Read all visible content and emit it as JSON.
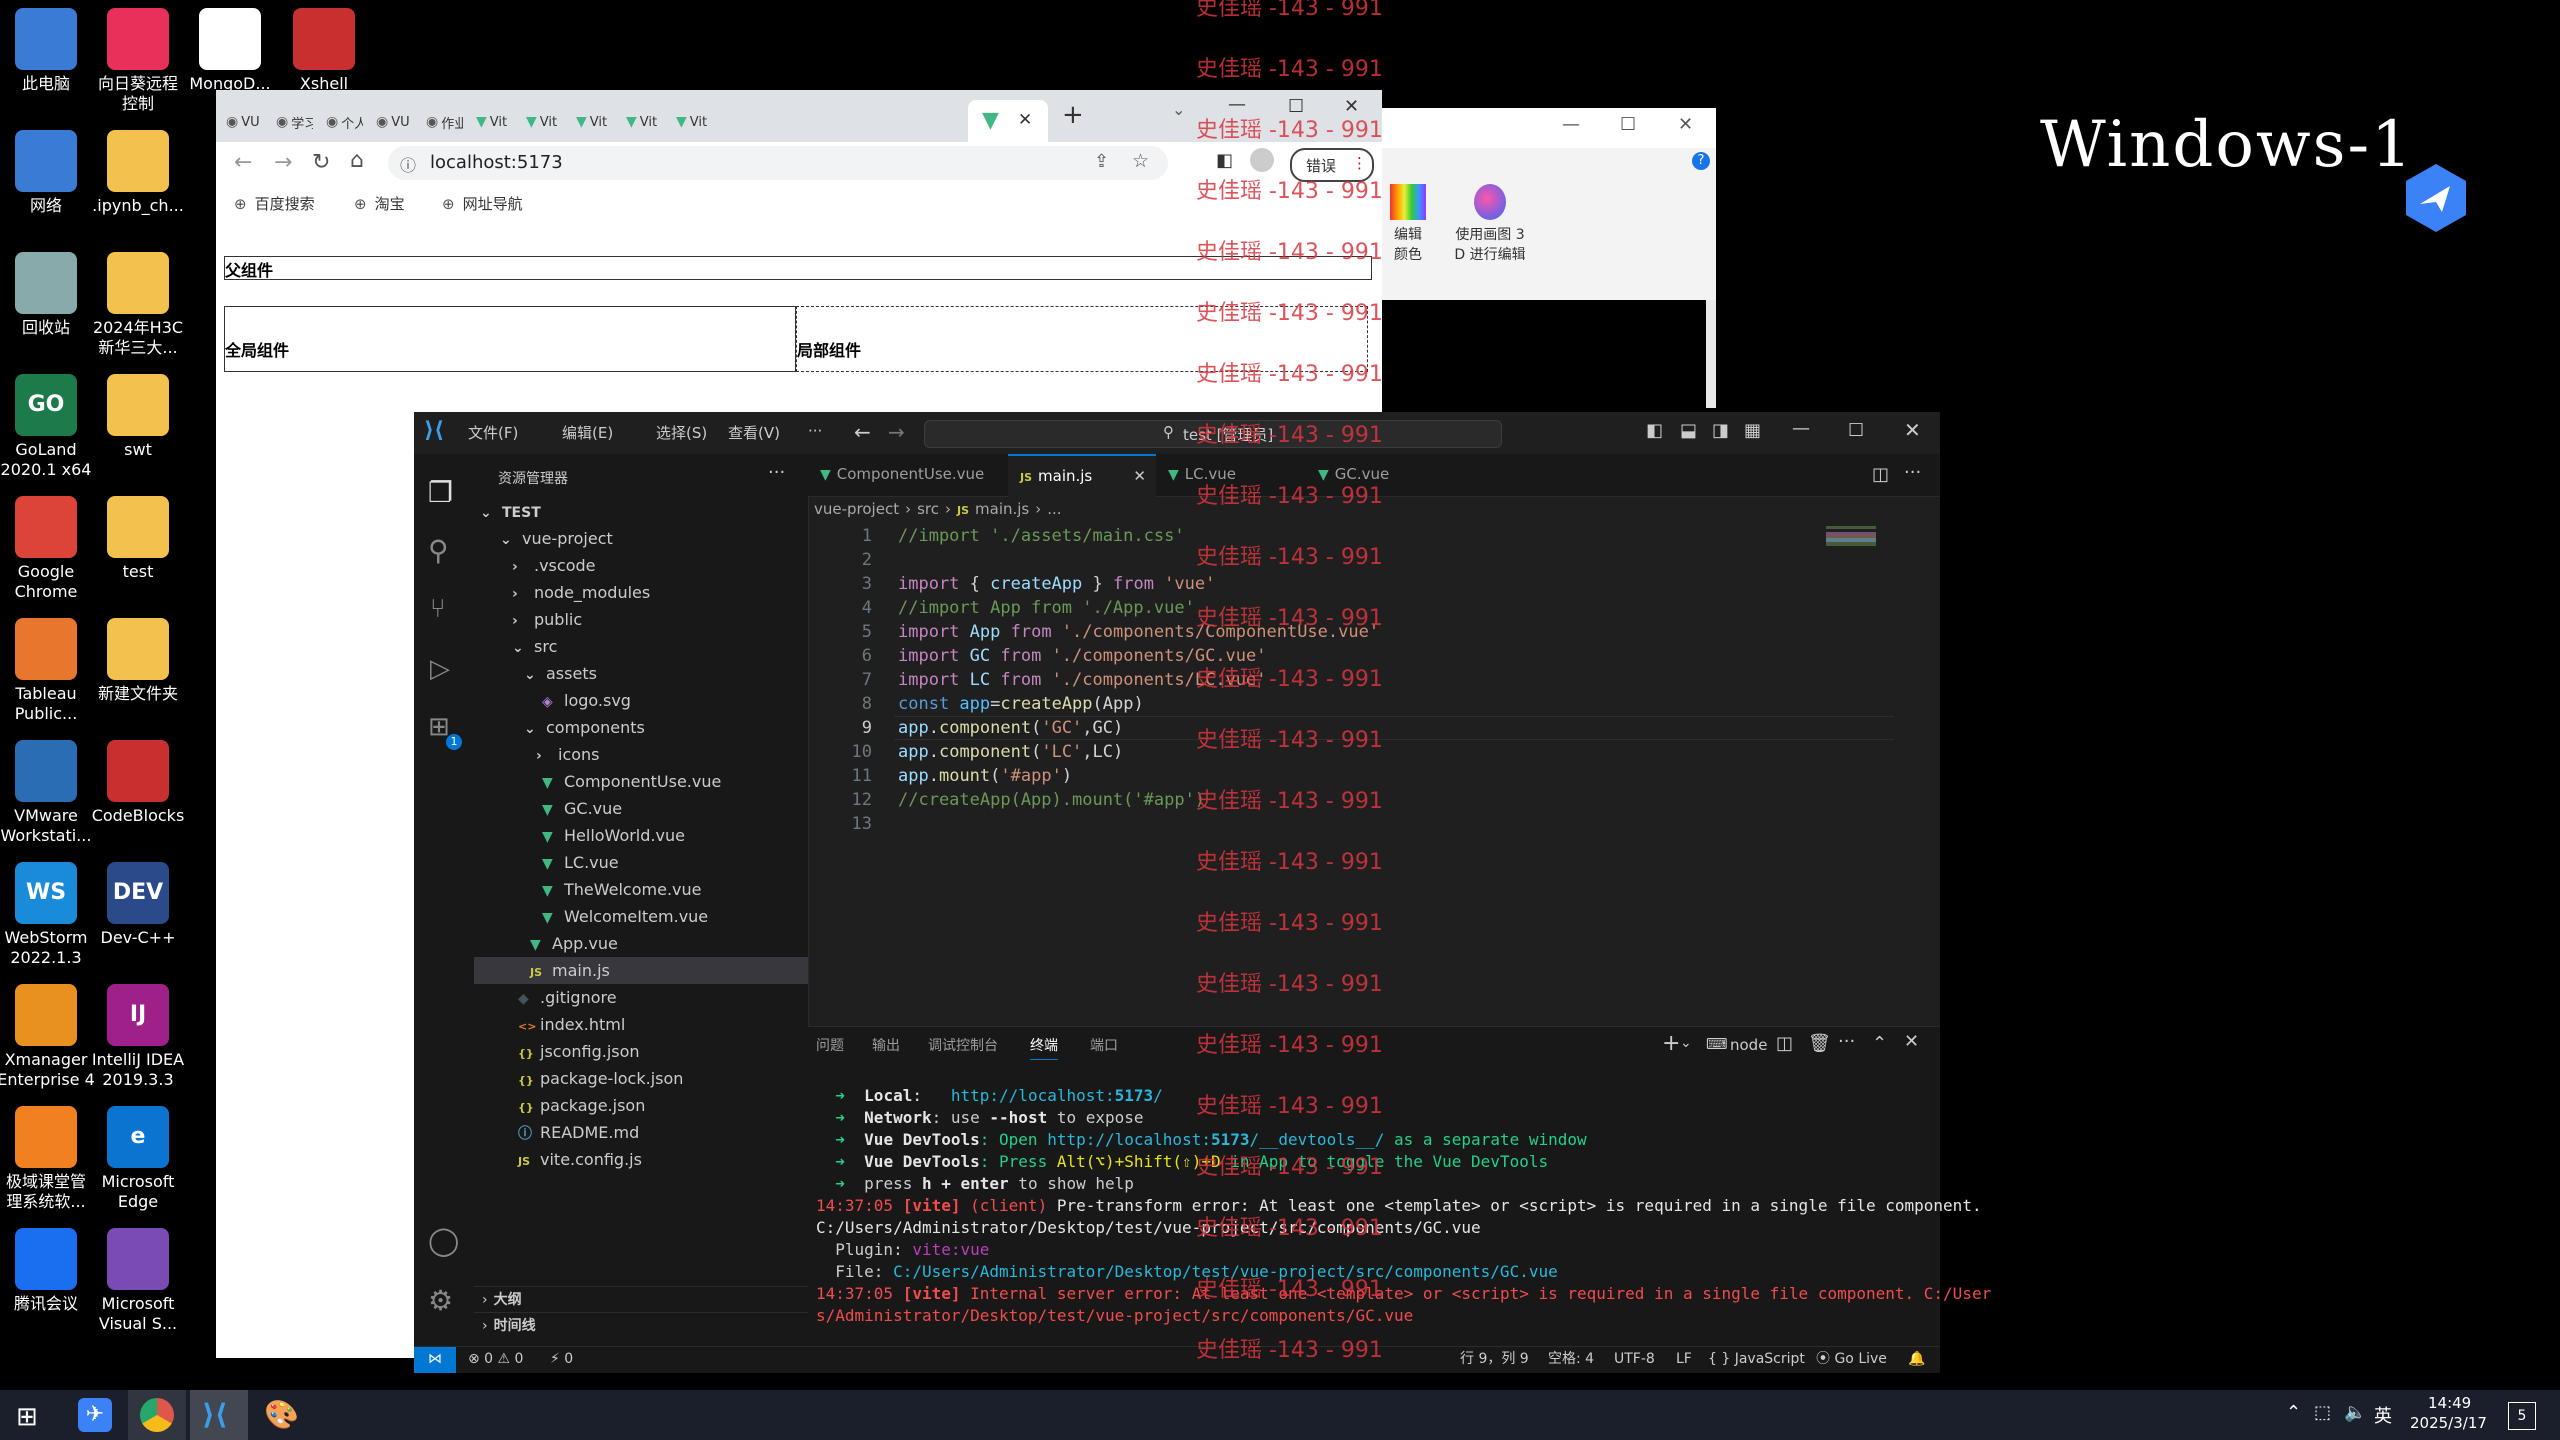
{
  "desktop": {
    "icons_col1": [
      {
        "label": "此电脑",
        "icon": "computer-icon",
        "color": "#3a7bd5"
      },
      {
        "label": "网络",
        "icon": "network-icon",
        "color": "#3a7bd5"
      },
      {
        "label": "回收站",
        "icon": "recycle-bin-icon",
        "color": "#8aa"
      },
      {
        "label": "GoLand\n2020.1 x64",
        "icon": "goland-icon",
        "color": "#1d7a4a",
        "text": "GO"
      },
      {
        "label": "Google\nChrome",
        "icon": "chrome-icon",
        "color": "#db4437"
      },
      {
        "label": "Tableau\nPublic...",
        "icon": "tableau-icon",
        "color": "#e8762d"
      },
      {
        "label": "VMware\nWorkstati...",
        "icon": "vmware-icon",
        "color": "#2a6db5"
      },
      {
        "label": "WebStorm\n2022.1.3",
        "icon": "webstorm-icon",
        "color": "#1a8bd8",
        "text": "WS"
      },
      {
        "label": "Xmanager\nEnterprise 4",
        "icon": "xmanager-icon",
        "color": "#e89020"
      },
      {
        "label": "极域课堂管\n理系统软...",
        "icon": "classroom-icon",
        "color": "#f08020"
      },
      {
        "label": "腾讯会议",
        "icon": "tencent-meeting-icon",
        "color": "#1a6ef0"
      }
    ],
    "icons_col2": [
      {
        "label": "向日葵远程\n控制",
        "icon": "sunlogin-icon",
        "color": "#e8305a"
      },
      {
        "label": ".ipynb_ch...",
        "icon": "folder-icon",
        "color": "#f2c14e"
      },
      {
        "label": "2024年H3C\n新华三大...",
        "icon": "folder-icon",
        "color": "#f2c14e"
      },
      {
        "label": "swt",
        "icon": "folder-icon",
        "color": "#f2c14e"
      },
      {
        "label": "test",
        "icon": "folder-icon",
        "color": "#f2c14e"
      },
      {
        "label": "新建文件夹",
        "icon": "folder-icon",
        "color": "#f2c14e"
      },
      {
        "label": "CodeBlocks",
        "icon": "codeblocks-icon",
        "color": "#c83030"
      },
      {
        "label": "Dev-C++",
        "icon": "devcpp-icon",
        "color": "#2a4a8a",
        "text": "DEV"
      },
      {
        "label": "IntelliJ IDEA\n2019.3.3",
        "icon": "intellij-icon",
        "color": "#a0208a",
        "text": "IJ"
      },
      {
        "label": "Microsoft\nEdge",
        "icon": "edge-icon",
        "color": "#0a74d0",
        "text": "e"
      },
      {
        "label": "Microsoft\nVisual S...",
        "icon": "visual-studio-icon",
        "color": "#7a4ab5"
      }
    ],
    "icons_top": [
      {
        "label": "MongoD...",
        "icon": "mongodb-icon",
        "color": "#fff"
      },
      {
        "label": "Xshell",
        "icon": "xshell-icon",
        "color": "#c83030"
      }
    ],
    "brand_text": "Windows-1",
    "watermark": "史佳瑶 -143 - 991"
  },
  "chrome": {
    "tabs": [
      "VU",
      "学习",
      "个人",
      "VU",
      "作业",
      "Vit",
      "Vit",
      "Vit",
      "Vit",
      "Vit"
    ],
    "new_tab_label": "+",
    "address": "localhost:5173",
    "error_chip": "错误",
    "bookmarks": [
      "百度搜索",
      "淘宝",
      "网址导航"
    ],
    "page": {
      "parent_title": "父组件",
      "global_title": "全局组件",
      "local_title": "局部组件"
    }
  },
  "explorer_window": {
    "btn1": "编辑\n颜色",
    "btn2": "使用画图 3\nD 进行编辑"
  },
  "vscode": {
    "menu": [
      "文件(F)",
      "编辑(E)",
      "选择(S)",
      "查看(V)",
      "···"
    ],
    "search_text": "test [管理员]",
    "sidebar_title": "资源管理器",
    "tree": [
      {
        "label": "TEST",
        "depth": 0,
        "kind": "root"
      },
      {
        "label": "vue-project",
        "depth": 1,
        "kind": "folder-open"
      },
      {
        "label": ".vscode",
        "depth": 2,
        "kind": "folder"
      },
      {
        "label": "node_modules",
        "depth": 2,
        "kind": "folder"
      },
      {
        "label": "public",
        "depth": 2,
        "kind": "folder"
      },
      {
        "label": "src",
        "depth": 2,
        "kind": "folder-open"
      },
      {
        "label": "assets",
        "depth": 3,
        "kind": "folder-open"
      },
      {
        "label": "logo.svg",
        "depth": 4,
        "kind": "svg"
      },
      {
        "label": "components",
        "depth": 3,
        "kind": "folder-open"
      },
      {
        "label": "icons",
        "depth": 4,
        "kind": "folder"
      },
      {
        "label": "ComponentUse.vue",
        "depth": 4,
        "kind": "vue"
      },
      {
        "label": "GC.vue",
        "depth": 4,
        "kind": "vue"
      },
      {
        "label": "HelloWorld.vue",
        "depth": 4,
        "kind": "vue"
      },
      {
        "label": "LC.vue",
        "depth": 4,
        "kind": "vue"
      },
      {
        "label": "TheWelcome.vue",
        "depth": 4,
        "kind": "vue"
      },
      {
        "label": "WelcomeItem.vue",
        "depth": 4,
        "kind": "vue"
      },
      {
        "label": "App.vue",
        "depth": 3,
        "kind": "vue"
      },
      {
        "label": "main.js",
        "depth": 3,
        "kind": "js",
        "active": true
      },
      {
        "label": ".gitignore",
        "depth": 2,
        "kind": "git"
      },
      {
        "label": "index.html",
        "depth": 2,
        "kind": "html"
      },
      {
        "label": "jsconfig.json",
        "depth": 2,
        "kind": "json"
      },
      {
        "label": "package-lock.json",
        "depth": 2,
        "kind": "json"
      },
      {
        "label": "package.json",
        "depth": 2,
        "kind": "json"
      },
      {
        "label": "README.md",
        "depth": 2,
        "kind": "md"
      },
      {
        "label": "vite.config.js",
        "depth": 2,
        "kind": "js"
      }
    ],
    "outline_label": "大纲",
    "timeline_label": "时间线",
    "editor_tabs": [
      {
        "label": "ComponentUse.vue",
        "kind": "vue",
        "active": false
      },
      {
        "label": "main.js",
        "kind": "js",
        "active": true
      },
      {
        "label": "LC.vue",
        "kind": "vue",
        "active": false
      },
      {
        "label": "GC.vue",
        "kind": "vue",
        "active": false
      }
    ],
    "breadcrumb": [
      "vue-project",
      "src",
      "main.js",
      "..."
    ],
    "code": [
      [
        {
          "t": "//import './assets/main.css'",
          "c": "#6a9955"
        }
      ],
      [],
      [
        {
          "t": "import",
          "c": "#c586c0"
        },
        {
          "t": " { ",
          "c": "#d4d4d4"
        },
        {
          "t": "createApp",
          "c": "#9cdcfe"
        },
        {
          "t": " } ",
          "c": "#d4d4d4"
        },
        {
          "t": "from",
          "c": "#c586c0"
        },
        {
          "t": " 'vue'",
          "c": "#ce9178"
        }
      ],
      [
        {
          "t": "//import App from './App.vue'",
          "c": "#6a9955"
        }
      ],
      [
        {
          "t": "import",
          "c": "#c586c0"
        },
        {
          "t": " App ",
          "c": "#9cdcfe"
        },
        {
          "t": "from",
          "c": "#c586c0"
        },
        {
          "t": " './components/ComponentUse.vue'",
          "c": "#ce9178"
        }
      ],
      [
        {
          "t": "import",
          "c": "#c586c0"
        },
        {
          "t": " GC ",
          "c": "#9cdcfe"
        },
        {
          "t": "from",
          "c": "#c586c0"
        },
        {
          "t": " './components/GC.vue'",
          "c": "#ce9178"
        }
      ],
      [
        {
          "t": "import",
          "c": "#c586c0"
        },
        {
          "t": " LC ",
          "c": "#9cdcfe"
        },
        {
          "t": "from",
          "c": "#c586c0"
        },
        {
          "t": " './components/LC.vue'",
          "c": "#ce9178"
        }
      ],
      [
        {
          "t": "const",
          "c": "#569cd6"
        },
        {
          "t": " app",
          "c": "#4fc1ff"
        },
        {
          "t": "=",
          "c": "#d4d4d4"
        },
        {
          "t": "createApp",
          "c": "#dcdcaa"
        },
        {
          "t": "(App)",
          "c": "#d4d4d4"
        }
      ],
      [
        {
          "t": "app",
          "c": "#9cdcfe"
        },
        {
          "t": ".",
          "c": "#d4d4d4"
        },
        {
          "t": "component",
          "c": "#dcdcaa"
        },
        {
          "t": "(",
          "c": "#d4d4d4"
        },
        {
          "t": "'GC'",
          "c": "#ce9178"
        },
        {
          "t": ",GC)",
          "c": "#d4d4d4"
        }
      ],
      [
        {
          "t": "app",
          "c": "#9cdcfe"
        },
        {
          "t": ".",
          "c": "#d4d4d4"
        },
        {
          "t": "component",
          "c": "#dcdcaa"
        },
        {
          "t": "(",
          "c": "#d4d4d4"
        },
        {
          "t": "'LC'",
          "c": "#ce9178"
        },
        {
          "t": ",LC)",
          "c": "#d4d4d4"
        }
      ],
      [
        {
          "t": "app",
          "c": "#9cdcfe"
        },
        {
          "t": ".",
          "c": "#d4d4d4"
        },
        {
          "t": "mount",
          "c": "#dcdcaa"
        },
        {
          "t": "(",
          "c": "#d4d4d4"
        },
        {
          "t": "'#app'",
          "c": "#ce9178"
        },
        {
          "t": ")",
          "c": "#d4d4d4"
        }
      ],
      [
        {
          "t": "//createApp(App).mount('#app')",
          "c": "#6a9955"
        }
      ],
      []
    ],
    "panel_tabs": [
      "问题",
      "输出",
      "调试控制台",
      "终端",
      "端口"
    ],
    "panel_active": "终端",
    "terminal_node_label": "node",
    "terminal": [
      [
        {
          "t": "  ➜  ",
          "c": "#23d18b"
        },
        {
          "t": "Local",
          "c": "#e5e5e5",
          "b": true
        },
        {
          "t": ":   ",
          "c": "#e5e5e5"
        },
        {
          "t": "http://localhost:",
          "c": "#29b8db"
        },
        {
          "t": "5173",
          "c": "#29b8db",
          "b": true
        },
        {
          "t": "/",
          "c": "#29b8db"
        }
      ],
      [
        {
          "t": "  ➜  ",
          "c": "#23d18b"
        },
        {
          "t": "Network",
          "c": "#e5e5e5",
          "b": true
        },
        {
          "t": ": use ",
          "c": "#ccc"
        },
        {
          "t": "--host",
          "c": "#e5e5e5",
          "b": true
        },
        {
          "t": " to expose",
          "c": "#ccc"
        }
      ],
      [
        {
          "t": "  ➜  ",
          "c": "#23d18b"
        },
        {
          "t": "Vue DevTools",
          "c": "#e5e5e5",
          "b": true
        },
        {
          "t": ": Open ",
          "c": "#23d18b"
        },
        {
          "t": "http://localhost:",
          "c": "#29b8db"
        },
        {
          "t": "5173",
          "c": "#29b8db",
          "b": true
        },
        {
          "t": "/__devtools__/",
          "c": "#29b8db"
        },
        {
          "t": " as a separate window",
          "c": "#23d18b"
        }
      ],
      [
        {
          "t": "  ➜  ",
          "c": "#23d18b"
        },
        {
          "t": "Vue DevTools",
          "c": "#e5e5e5",
          "b": true
        },
        {
          "t": ": Press ",
          "c": "#23d18b"
        },
        {
          "t": "Alt(⌥)+Shift(⇧)+D",
          "c": "#e5e510"
        },
        {
          "t": " in App to toggle the Vue DevTools",
          "c": "#23d18b"
        }
      ],
      [
        {
          "t": "  ➜  ",
          "c": "#23d18b"
        },
        {
          "t": "press ",
          "c": "#ccc"
        },
        {
          "t": "h + enter",
          "c": "#e5e5e5",
          "b": true
        },
        {
          "t": " to show help",
          "c": "#ccc"
        }
      ],
      [
        {
          "t": "14:37:05 ",
          "c": "#f14c4c"
        },
        {
          "t": "[vite]",
          "c": "#f14c4c",
          "b": true
        },
        {
          "t": " (client) ",
          "c": "#f14c4c"
        },
        {
          "t": "Pre-transform error: At least one <template> or <script> is required in a single file component.",
          "c": "#e5e5e5"
        }
      ],
      [
        {
          "t": "C:/Users/Administrator/Desktop/test/vue-project/src/components/GC.vue",
          "c": "#e5e5e5"
        }
      ],
      [
        {
          "t": "  Plugin: ",
          "c": "#ccc"
        },
        {
          "t": "vite:vue",
          "c": "#bc3fbc"
        }
      ],
      [
        {
          "t": "  File: ",
          "c": "#ccc"
        },
        {
          "t": "C:/Users/Administrator/Desktop/test/vue-project/src/components/GC.vue",
          "c": "#29b8db"
        }
      ],
      [
        {
          "t": "14:37:05 ",
          "c": "#f14c4c"
        },
        {
          "t": "[vite]",
          "c": "#f14c4c",
          "b": true
        },
        {
          "t": " Internal server error: At least one <template> or <script> is required in a single file component. C:/User",
          "c": "#f14c4c"
        }
      ],
      [
        {
          "t": "s/Administrator/Desktop/test/vue-project/src/components/GC.vue",
          "c": "#f14c4c"
        }
      ]
    ],
    "status": {
      "errors": "⊗ 0 ⚠ 0",
      "ports": "⚡ 0",
      "position": "行 9，列 9",
      "spaces": "空格: 4",
      "encoding": "UTF-8",
      "eol": "LF",
      "language": "{ } JavaScript",
      "golive": "⦿ Go Live"
    }
  },
  "taskbar": {
    "ime": "英",
    "time": "14:49",
    "date": "2025/3/17",
    "notif_count": "5"
  }
}
